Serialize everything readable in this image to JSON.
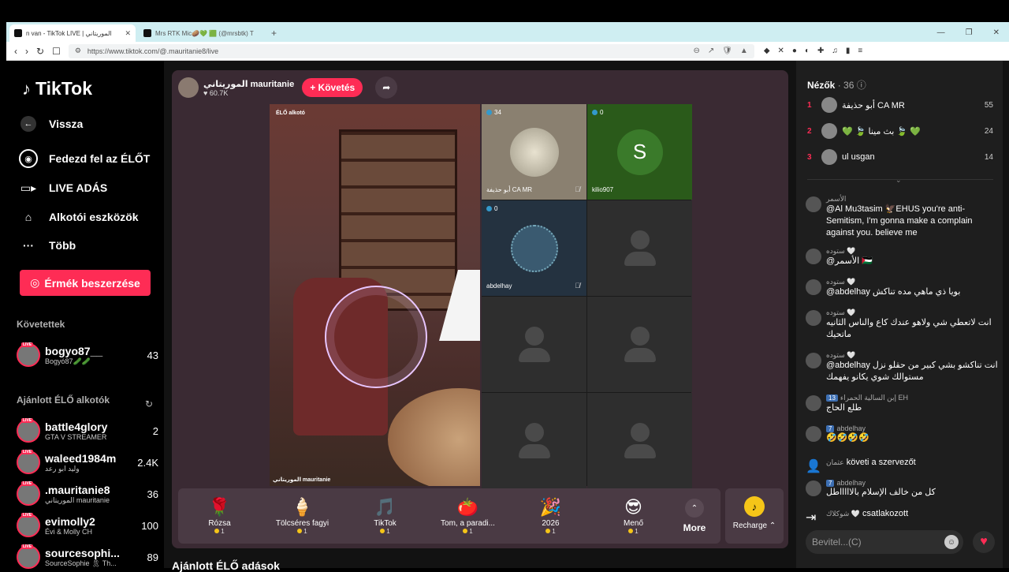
{
  "browser": {
    "tabs": [
      {
        "label": "n van - TikTok LIVE | الموريتاني"
      },
      {
        "label": "Mrs RTK Mic🥔💚 🟩 (@mrsbtk) T"
      }
    ],
    "new_tab": "+",
    "url": "https://www.tiktok.com/@.mauritanie8/live"
  },
  "sidebar": {
    "logo": "TikTok",
    "nav": [
      {
        "label": "Vissza",
        "icon": "back-arrow-icon"
      },
      {
        "label": "Fedezd fel az ÉLŐT",
        "icon": "explore-icon"
      },
      {
        "label": "LIVE ADÁS",
        "icon": "camera-icon"
      },
      {
        "label": "Alkotói eszközök",
        "icon": "creator-tools-icon"
      },
      {
        "label": "Több",
        "icon": "more-dots-icon"
      }
    ],
    "coins_button": "Érmék beszerzése",
    "following_title": "Követettek",
    "following": [
      {
        "name": "bogyo87__",
        "sub": "Bogyó87🥒🥒",
        "count": "43"
      }
    ],
    "recommended_title": "Ajánlott ÉLŐ alkotók",
    "recommended": [
      {
        "name": "battle4glory",
        "sub": "GTA V STREAMER",
        "count": "2"
      },
      {
        "name": "waleed1984m",
        "sub": "وليد ابو رعد",
        "count": "2.4K"
      },
      {
        "name": ".mauritanie8",
        "sub": "الموريتاني mauritanie",
        "count": "36"
      },
      {
        "name": "evimolly2",
        "sub": "Évi & Molly CH",
        "count": "100"
      },
      {
        "name": "sourcesophi...",
        "sub": "SourceSophie 🎗 Th...",
        "count": "89"
      }
    ]
  },
  "stream": {
    "host_name": "الموريتاني mauritanie",
    "host_likes": "♥ 60.7K",
    "follow_button": "+ Követés",
    "main_label": "ÉLŐ alkotó",
    "main_caption": "الموريتاني mauritanie",
    "guests": [
      {
        "count": "34",
        "name": "أبو حذيفة CA MR"
      },
      {
        "count": "0",
        "name": "kilio907",
        "letter": "S"
      },
      {
        "count": "0",
        "name": "abdelhay"
      }
    ],
    "gifts": [
      {
        "name": "Rózsa",
        "price": "1",
        "icon": "🌹"
      },
      {
        "name": "Tölcséres fagyi",
        "price": "1",
        "icon": "🍦"
      },
      {
        "name": "TikTok",
        "price": "1",
        "icon": "🎵"
      },
      {
        "name": "Tom, a paradi...",
        "price": "1",
        "icon": "🍅"
      },
      {
        "name": "2026",
        "price": "1",
        "icon": "🎉"
      },
      {
        "name": "Menő",
        "price": "1",
        "icon": "😎"
      }
    ],
    "more_label": "More",
    "recharge_label": "Recharge ⌃"
  },
  "recommended_lives": "Ajánlott ÉLŐ adások",
  "chat": {
    "viewers_title": "Nézők",
    "viewers_count": "· 36",
    "top": [
      {
        "rank": "1",
        "name": "أبو حذيفة CA MR",
        "score": "55"
      },
      {
        "rank": "2",
        "name": "💚 🍃 بث مينا 🍃 💚",
        "score": "24"
      },
      {
        "rank": "3",
        "name": "ul usgan",
        "score": "14"
      }
    ],
    "messages": [
      {
        "user": "الأسمر",
        "text": "@Al Mu3tasim 🦅EHUS you're anti-Semitism, I'm gonna make a complain against you. believe me"
      },
      {
        "user": "ستوده 🤍",
        "text": "@الأسمر 🇵🇸"
      },
      {
        "user": "ستوده 🤍",
        "text": "@abdelhay بويا ذي ماهي مده تناكش"
      },
      {
        "user": "ستوده 🤍",
        "text": "انت لاتعطي شي ولاهو عندك كاع والناس الثانيه ماتحيك"
      },
      {
        "user": "ستوده 🤍",
        "text": "@abdelhay انت تناكشو بشي كبير من حقلو نزل مستوالك شوي يكانو يفهمك"
      },
      {
        "level": "13",
        "user": "إبن السالية الحمراء EH",
        "text": "طلع الحاج"
      },
      {
        "level": "7",
        "user": "abdelhay",
        "text": "🤣🤣🤣🤣"
      },
      {
        "user": "عثمان",
        "text": "követi a szervezőt"
      },
      {
        "level": "7",
        "user": "abdelhay",
        "text": "كل من خالف الإسلام بالاااااطل"
      },
      {
        "user": "شوكلاك 🤍",
        "text": "csatlakozott"
      }
    ],
    "input_placeholder": "Bevitel...(C)"
  }
}
